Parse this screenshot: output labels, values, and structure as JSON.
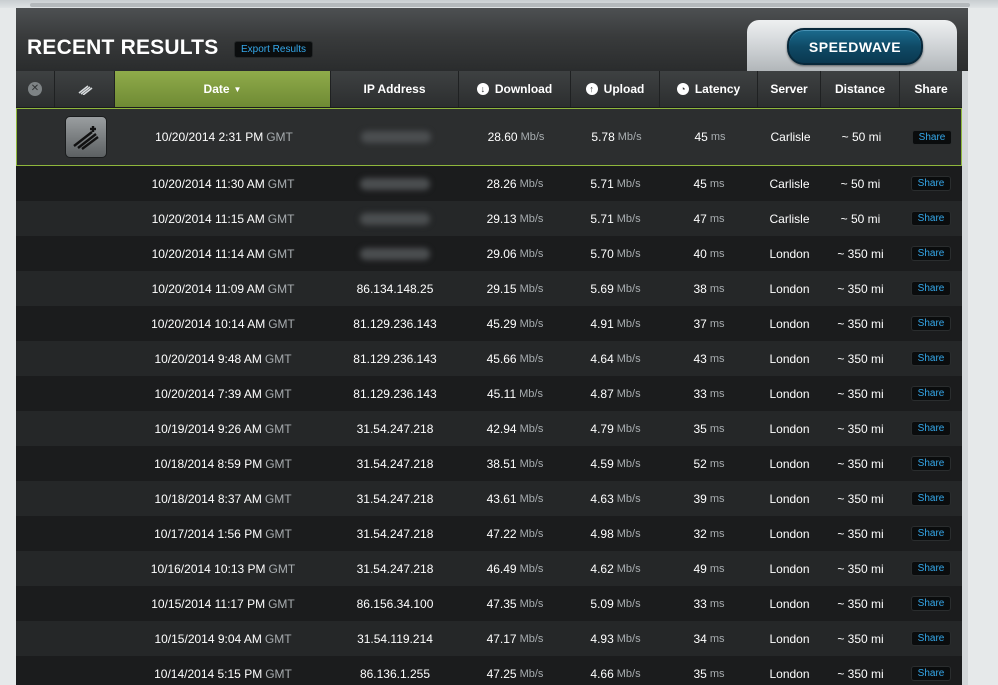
{
  "panel": {
    "title": "RECENT RESULTS",
    "export_label": "Export Results",
    "speedwave_label": "SPEEDWAVE"
  },
  "columns": {
    "date": "Date",
    "ip": "IP Address",
    "download": "Download",
    "upload": "Upload",
    "latency": "Latency",
    "server": "Server",
    "distance": "Distance",
    "share": "Share"
  },
  "units": {
    "speed": "Mb/s",
    "latency": "ms",
    "tz": "GMT"
  },
  "share_label": "Share",
  "rows": [
    {
      "date": "10/20/2014 2:31 PM",
      "ip": "",
      "download": "28.60",
      "upload": "5.78",
      "latency": "45",
      "server": "Carlisle",
      "distance": "~ 50 mi"
    },
    {
      "date": "10/20/2014 11:30 AM",
      "ip": "",
      "download": "28.26",
      "upload": "5.71",
      "latency": "45",
      "server": "Carlisle",
      "distance": "~ 50 mi"
    },
    {
      "date": "10/20/2014 11:15 AM",
      "ip": "",
      "download": "29.13",
      "upload": "5.71",
      "latency": "47",
      "server": "Carlisle",
      "distance": "~ 50 mi"
    },
    {
      "date": "10/20/2014 11:14 AM",
      "ip": "",
      "download": "29.06",
      "upload": "5.70",
      "latency": "40",
      "server": "London",
      "distance": "~ 350 mi"
    },
    {
      "date": "10/20/2014 11:09 AM",
      "ip": "86.134.148.25",
      "download": "29.15",
      "upload": "5.69",
      "latency": "38",
      "server": "London",
      "distance": "~ 350 mi"
    },
    {
      "date": "10/20/2014 10:14 AM",
      "ip": "81.129.236.143",
      "download": "45.29",
      "upload": "4.91",
      "latency": "37",
      "server": "London",
      "distance": "~ 350 mi"
    },
    {
      "date": "10/20/2014 9:48 AM",
      "ip": "81.129.236.143",
      "download": "45.66",
      "upload": "4.64",
      "latency": "43",
      "server": "London",
      "distance": "~ 350 mi"
    },
    {
      "date": "10/20/2014 7:39 AM",
      "ip": "81.129.236.143",
      "download": "45.11",
      "upload": "4.87",
      "latency": "33",
      "server": "London",
      "distance": "~ 350 mi"
    },
    {
      "date": "10/19/2014 9:26 AM",
      "ip": "31.54.247.218",
      "download": "42.94",
      "upload": "4.79",
      "latency": "35",
      "server": "London",
      "distance": "~ 350 mi"
    },
    {
      "date": "10/18/2014 8:59 PM",
      "ip": "31.54.247.218",
      "download": "38.51",
      "upload": "4.59",
      "latency": "52",
      "server": "London",
      "distance": "~ 350 mi"
    },
    {
      "date": "10/18/2014 8:37 AM",
      "ip": "31.54.247.218",
      "download": "43.61",
      "upload": "4.63",
      "latency": "39",
      "server": "London",
      "distance": "~ 350 mi"
    },
    {
      "date": "10/17/2014 1:56 PM",
      "ip": "31.54.247.218",
      "download": "47.22",
      "upload": "4.98",
      "latency": "32",
      "server": "London",
      "distance": "~ 350 mi"
    },
    {
      "date": "10/16/2014 10:13 PM",
      "ip": "31.54.247.218",
      "download": "46.49",
      "upload": "4.62",
      "latency": "49",
      "server": "London",
      "distance": "~ 350 mi"
    },
    {
      "date": "10/15/2014 11:17 PM",
      "ip": "86.156.34.100",
      "download": "47.35",
      "upload": "5.09",
      "latency": "33",
      "server": "London",
      "distance": "~ 350 mi"
    },
    {
      "date": "10/15/2014 9:04 AM",
      "ip": "31.54.119.214",
      "download": "47.17",
      "upload": "4.93",
      "latency": "34",
      "server": "London",
      "distance": "~ 350 mi"
    },
    {
      "date": "10/14/2014 5:15 PM",
      "ip": "86.136.1.255",
      "download": "47.25",
      "upload": "4.66",
      "latency": "35",
      "server": "London",
      "distance": "~ 350 mi"
    }
  ],
  "colors": {
    "accent_green": "#8fb73c",
    "link_blue": "#35a8ea",
    "speedwave_blue": "#0f4a66"
  }
}
